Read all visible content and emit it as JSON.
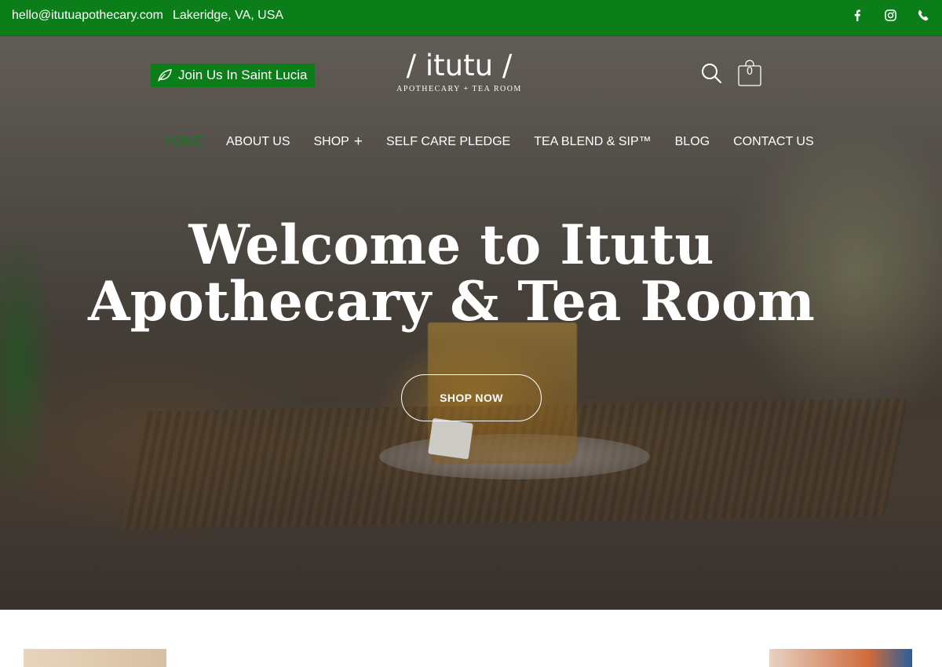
{
  "topbar": {
    "email": "hello@itutuapothecary.com",
    "location": "Lakeridge, VA, USA",
    "social_icons": [
      "facebook-icon",
      "instagram-icon",
      "phone-icon"
    ]
  },
  "header": {
    "join_button_label": "Join Us In Saint Lucia",
    "logo_wordmark": "/ itutu /",
    "logo_subtitle": "APOTHECARY + TEA ROOM",
    "cart_count": "0"
  },
  "nav": {
    "items": [
      {
        "label": "HOME",
        "active": true
      },
      {
        "label": "ABOUT US"
      },
      {
        "label": "SHOP",
        "has_submenu": true
      },
      {
        "label": "SELF CARE PLEDGE"
      },
      {
        "label": "TEA BLEND & SIP™"
      },
      {
        "label": "BLOG"
      },
      {
        "label": "CONTACT US"
      }
    ]
  },
  "hero": {
    "title_line1": "Welcome to Itutu",
    "title_line2": "Apothecary & Tea Room",
    "cta_label": "SHOP NOW"
  },
  "colors": {
    "brand_green": "#0b7e19",
    "text_light": "#ffffff"
  }
}
